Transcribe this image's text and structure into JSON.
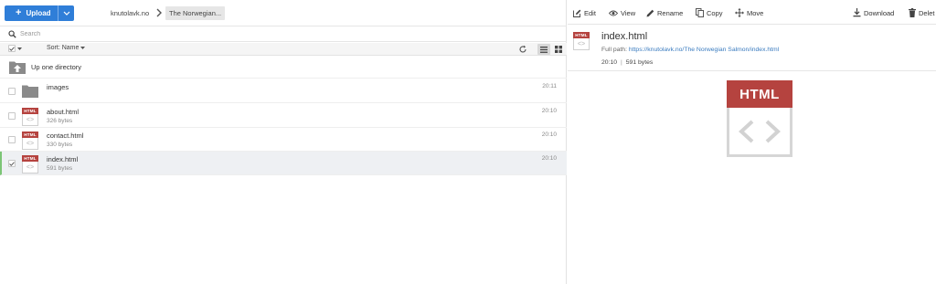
{
  "toolbar": {
    "upload_label": "Upload"
  },
  "breadcrumb": {
    "root": "knutolavk.no",
    "current": "The Norwegian..."
  },
  "search": {
    "placeholder": "Search"
  },
  "sort": {
    "label": "Sort: Name"
  },
  "up_directory": {
    "label": "Up one directory"
  },
  "files": [
    {
      "name": "images",
      "size": "",
      "time": "20:11",
      "type": "folder"
    },
    {
      "name": "about.html",
      "size": "326 bytes",
      "time": "20:10",
      "type": "html"
    },
    {
      "name": "contact.html",
      "size": "330 bytes",
      "time": "20:10",
      "type": "html"
    },
    {
      "name": "index.html",
      "size": "591 bytes",
      "time": "20:10",
      "type": "html",
      "selected": true
    }
  ],
  "file_icon_label": "HTML",
  "actions": {
    "edit": "Edit",
    "view": "View",
    "rename": "Rename",
    "copy": "Copy",
    "move": "Move",
    "download": "Download",
    "delete": "Delet"
  },
  "preview": {
    "title": "index.html",
    "full_path_label": "Full path:",
    "full_path_url": "https://knutolavk.no/The Norwegian Salmon/index.html",
    "time": "20:10",
    "size": "591 bytes",
    "icon_label": "HTML"
  },
  "colors": {
    "accent": "#2f7ed8",
    "html_red": "#b5433f",
    "selected_bar": "#7cc576",
    "link": "#3a7bbf"
  }
}
